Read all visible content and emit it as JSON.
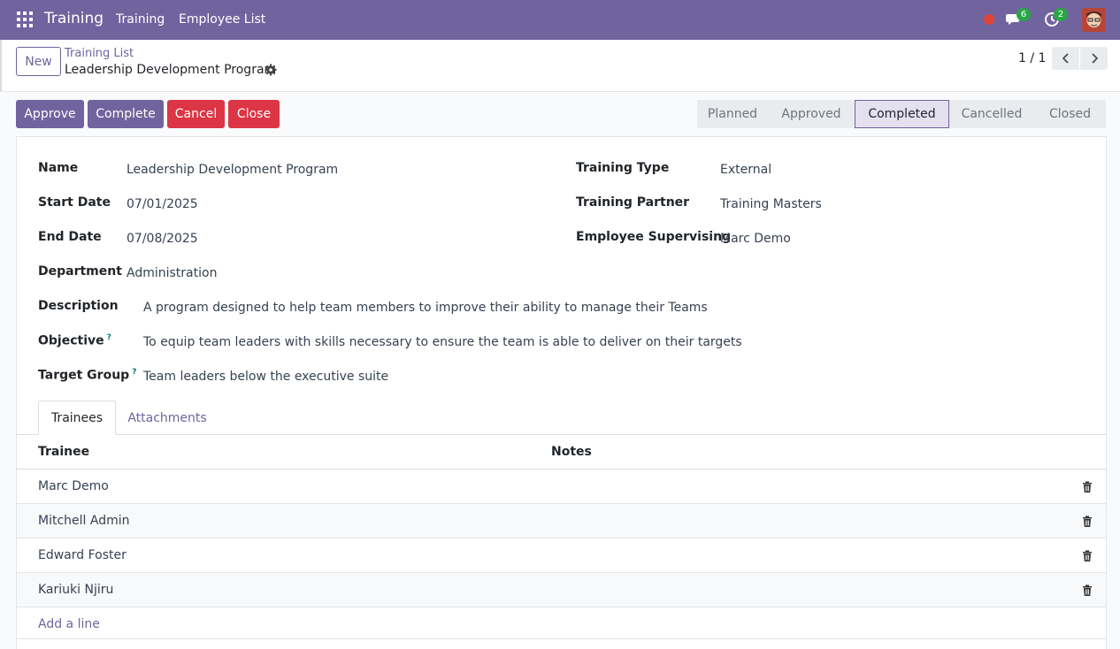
{
  "navbar": {
    "app_name": "Training",
    "menu": [
      "Training",
      "Employee List"
    ],
    "messages_count": "6",
    "activities_count": "2",
    "status_dot_color": "#e0453a",
    "icons": [
      "apps-grid-icon",
      "chat-icon",
      "clock-icon",
      "user-avatar"
    ]
  },
  "control": {
    "new_label": "New",
    "breadcrumb": "Training List",
    "record_title": "Leadership Development Program",
    "pager": "1 / 1"
  },
  "actions": {
    "approve": "Approve",
    "complete": "Complete",
    "cancel": "Cancel",
    "close": "Close"
  },
  "status": {
    "stages": [
      "Planned",
      "Approved",
      "Completed",
      "Cancelled",
      "Closed"
    ],
    "active": "Completed"
  },
  "form": {
    "name_label": "Name",
    "name": "Leadership Development Program",
    "start_label": "Start Date",
    "start": "07/01/2025",
    "end_label": "End Date",
    "end": "07/08/2025",
    "dept_label": "Department",
    "dept": "Administration",
    "type_label": "Training Type",
    "type": "External",
    "partner_label": "Training Partner",
    "partner": "Training Masters",
    "supervisor_label": "Employee Supervising",
    "supervisor": "Marc Demo",
    "description_label": "Description",
    "description": "A program designed to help team members to improve their ability to manage their Teams",
    "objective_label": "Objective",
    "objective": "To equip team leaders with skills necessary to ensure the team is able to deliver on their targets",
    "target_label": "Target Group",
    "target": "Team leaders below the executive suite",
    "help_mark": "?"
  },
  "tabs": [
    "Trainees",
    "Attachments"
  ],
  "table": {
    "headers": [
      "Trainee",
      "Notes"
    ],
    "rows": [
      "Marc Demo",
      "Mitchell Admin",
      "Edward Foster",
      "Kariuki Njiru"
    ],
    "add_line": "Add a line"
  },
  "colors": {
    "brand": "#71639e",
    "danger": "#dc3545",
    "badge": "#28a745"
  }
}
